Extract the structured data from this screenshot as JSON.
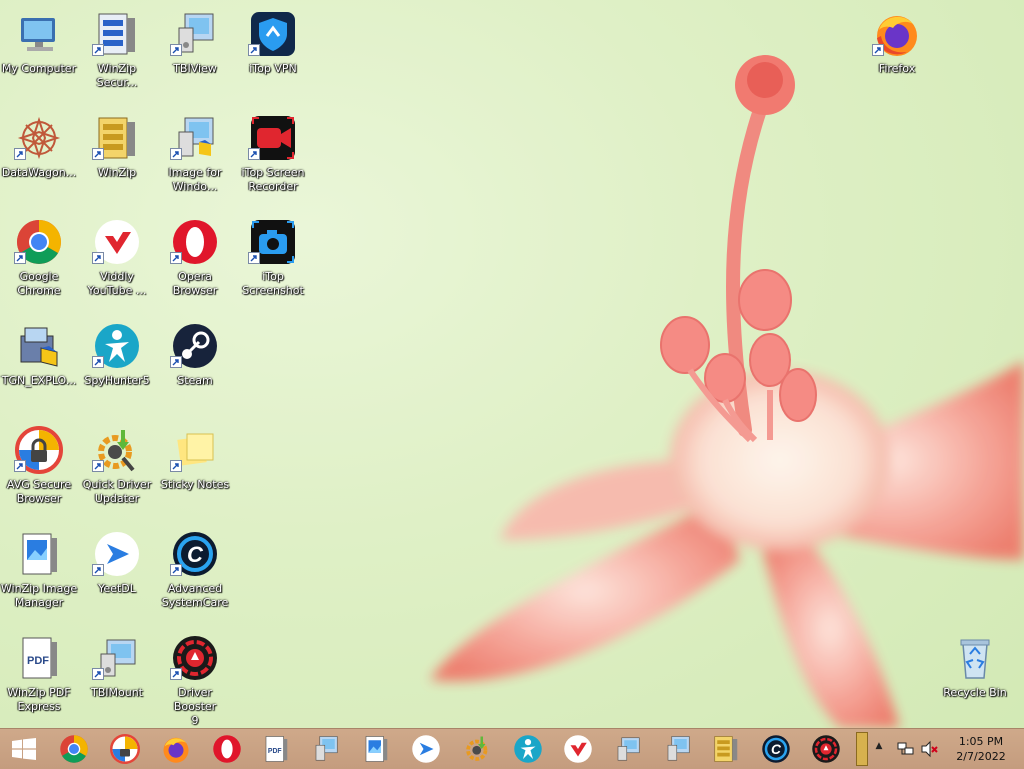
{
  "desktop": {
    "icons": [
      {
        "label": "My Computer",
        "icon": "computer-icon",
        "shortcut": false
      },
      {
        "label": "WinZip\nSecur...",
        "icon": "winzip-secure-icon",
        "shortcut": true
      },
      {
        "label": "TBIView",
        "icon": "tbiview-icon",
        "shortcut": true
      },
      {
        "label": "iTop VPN",
        "icon": "itop-vpn-icon",
        "shortcut": true
      },
      {
        "label": "Firefox",
        "icon": "firefox-icon",
        "shortcut": true
      },
      {
        "label": "DataWagon...",
        "icon": "datawagon-icon",
        "shortcut": true
      },
      {
        "label": "WinZip",
        "icon": "winzip-icon",
        "shortcut": true
      },
      {
        "label": "Image for\nWindo...",
        "icon": "image-for-windows-icon",
        "shortcut": true
      },
      {
        "label": "iTop Screen\nRecorder",
        "icon": "itop-screen-recorder-icon",
        "shortcut": true
      },
      {
        "label": "Google\nChrome",
        "icon": "chrome-icon",
        "shortcut": true
      },
      {
        "label": "Viddly\nYouTube ...",
        "icon": "viddly-icon",
        "shortcut": true
      },
      {
        "label": "Opera\nBrowser",
        "icon": "opera-icon",
        "shortcut": true
      },
      {
        "label": "iTop\nScreenshot",
        "icon": "itop-screenshot-icon",
        "shortcut": true
      },
      {
        "label": "TGN_EXPLO...",
        "icon": "tgn-explorer-icon",
        "shortcut": false
      },
      {
        "label": "SpyHunter5",
        "icon": "spyhunter-icon",
        "shortcut": true
      },
      {
        "label": "Steam",
        "icon": "steam-icon",
        "shortcut": true
      },
      {
        "label": "AVG Secure\nBrowser",
        "icon": "avg-secure-browser-icon",
        "shortcut": true
      },
      {
        "label": "Quick Driver\nUpdater",
        "icon": "quick-driver-updater-icon",
        "shortcut": true
      },
      {
        "label": "Sticky Notes",
        "icon": "sticky-notes-icon",
        "shortcut": true
      },
      {
        "label": "WinZip Image\nManager",
        "icon": "winzip-image-manager-icon",
        "shortcut": false
      },
      {
        "label": "YeetDL",
        "icon": "yeetdl-icon",
        "shortcut": true
      },
      {
        "label": "Advanced\nSystemCare",
        "icon": "advanced-systemcare-icon",
        "shortcut": true
      },
      {
        "label": "WinZip PDF\nExpress",
        "icon": "winzip-pdf-icon",
        "shortcut": false
      },
      {
        "label": "TBIMount",
        "icon": "tbimount-icon",
        "shortcut": true
      },
      {
        "label": "Driver Booster\n9",
        "icon": "driver-booster-icon",
        "shortcut": true
      },
      {
        "label": "Recycle Bin",
        "icon": "recycle-bin-icon",
        "shortcut": false
      }
    ]
  },
  "taskbar": {
    "start_icon": "windows-logo-icon",
    "pinned": [
      {
        "icon": "chrome-icon"
      },
      {
        "icon": "avg-secure-browser-icon"
      },
      {
        "icon": "firefox-icon"
      },
      {
        "icon": "opera-icon"
      },
      {
        "icon": "winzip-pdf-icon"
      },
      {
        "icon": "tbiview-icon"
      },
      {
        "icon": "winzip-image-manager-icon"
      },
      {
        "icon": "yeetdl-icon"
      },
      {
        "icon": "quick-driver-updater-icon"
      },
      {
        "icon": "spyhunter-icon"
      },
      {
        "icon": "viddly-icon"
      },
      {
        "icon": "tbimount-icon"
      },
      {
        "icon": "image-for-windows-icon"
      },
      {
        "icon": "winzip-icon"
      },
      {
        "icon": "advanced-systemcare-icon"
      },
      {
        "icon": "driver-booster-icon"
      }
    ],
    "tray": {
      "show_hidden": "▲",
      "time": "1:05 PM",
      "date": "2/7/2022"
    }
  }
}
